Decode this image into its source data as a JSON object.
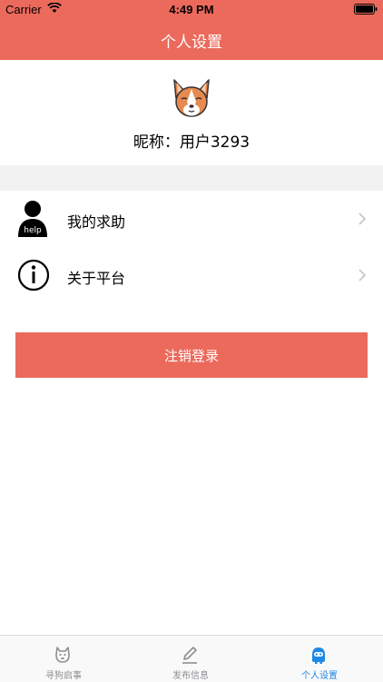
{
  "status_bar": {
    "carrier": "Carrier",
    "time": "4:49 PM"
  },
  "header": {
    "title": "个人设置"
  },
  "profile": {
    "nickname": "昵称：用户3293",
    "avatar_icon": "dog-face-icon"
  },
  "menu": [
    {
      "label": "我的求助",
      "icon": "help-person-icon"
    },
    {
      "label": "关于平台",
      "icon": "info-circle-icon"
    }
  ],
  "logout": {
    "label": "注销登录"
  },
  "tabbar": {
    "tabs": [
      {
        "label": "寻狗启事",
        "icon": "dog-icon",
        "active": false
      },
      {
        "label": "发布信息",
        "icon": "edit-icon",
        "active": false
      },
      {
        "label": "个人设置",
        "icon": "robot-icon",
        "active": true
      }
    ]
  },
  "colors": {
    "accent": "#EC6A5C",
    "tab_active": "#1E88E5",
    "tab_inactive": "#8E8E93"
  }
}
